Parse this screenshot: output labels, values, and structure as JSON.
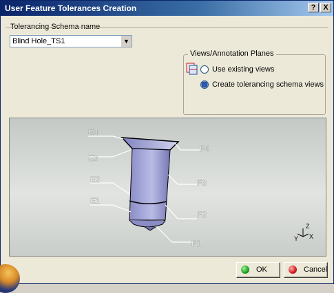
{
  "window": {
    "title": "User Feature Tolerances Creation",
    "help_label": "?",
    "close_label": "X"
  },
  "schema": {
    "group_label": "Tolerancing Schema name",
    "selected_value": "Blind Hole_TS1"
  },
  "views": {
    "group_label": "Views/Annotation Planes",
    "options": [
      {
        "label": "Use existing views",
        "checked": false
      },
      {
        "label": "Create tolerancing schema views",
        "checked": true
      }
    ]
  },
  "viewer": {
    "labels": [
      "E4",
      "E3",
      "E2",
      "E1",
      "F4",
      "F3",
      "F2",
      "F1"
    ],
    "axis": {
      "x": "X",
      "y": "Y",
      "z": "Z"
    }
  },
  "buttons": {
    "ok_label": "OK",
    "cancel_label": "Cancel"
  },
  "colors": {
    "accent": "#0a246a",
    "ok_icon": "#1fa21f",
    "cancel_icon": "#d21c1c"
  },
  "icons": {
    "help": "question-mark-icon",
    "close": "close-icon",
    "views": "view-planes-icon",
    "ok": "green-circle-icon",
    "cancel": "red-circle-icon"
  }
}
